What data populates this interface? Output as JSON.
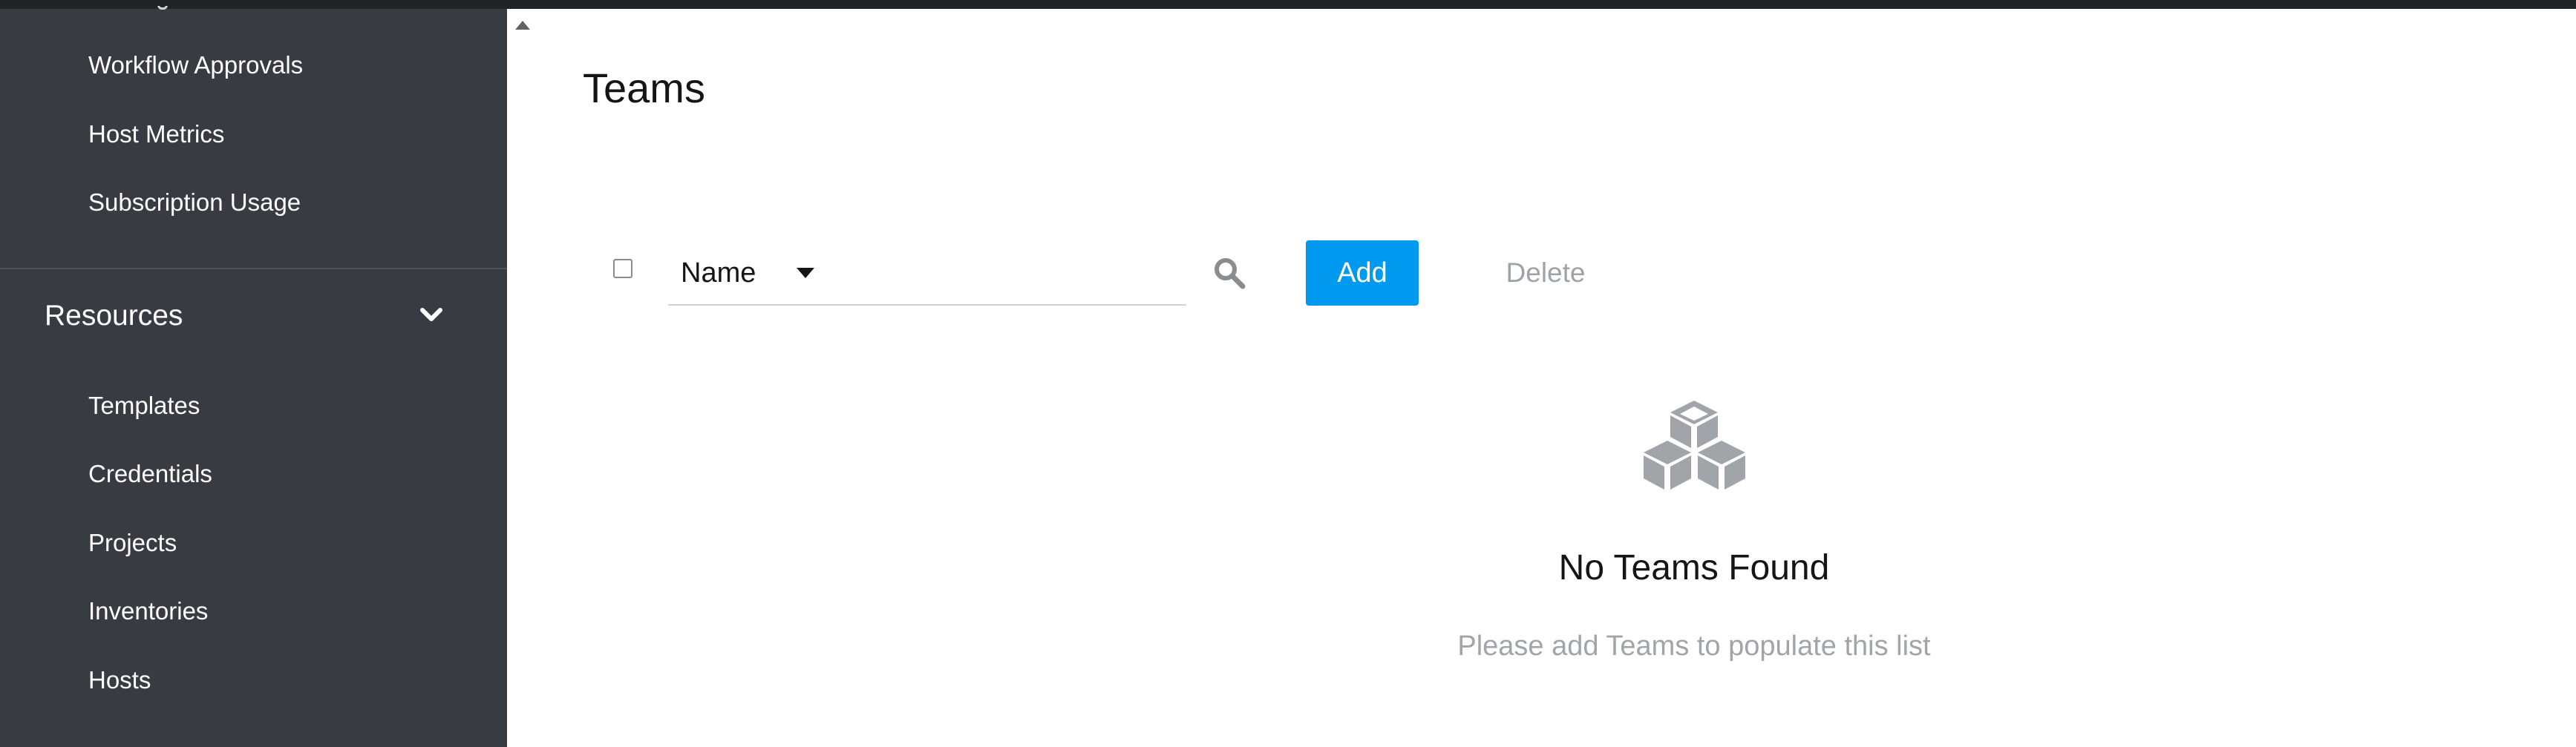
{
  "sidebar": {
    "items_top": [
      {
        "label": "Workflow Approvals"
      },
      {
        "label": "Host Metrics"
      },
      {
        "label": "Subscription Usage"
      }
    ],
    "resources_group": {
      "title": "Resources",
      "items": [
        {
          "label": "Templates"
        },
        {
          "label": "Credentials"
        },
        {
          "label": "Projects"
        },
        {
          "label": "Inventories"
        },
        {
          "label": "Hosts"
        }
      ]
    }
  },
  "main": {
    "title": "Teams",
    "toolbar": {
      "filter_value": "Name",
      "add_label": "Add",
      "delete_label": "Delete"
    },
    "empty_state": {
      "title": "No Teams Found",
      "body": "Please add Teams to populate this list",
      "icon": "cubes-icon"
    }
  },
  "colors": {
    "sidebar_bg": "#383c42",
    "topbar_bg": "#212427",
    "accent": "#0099f0",
    "muted_text": "#a1a5aa"
  }
}
